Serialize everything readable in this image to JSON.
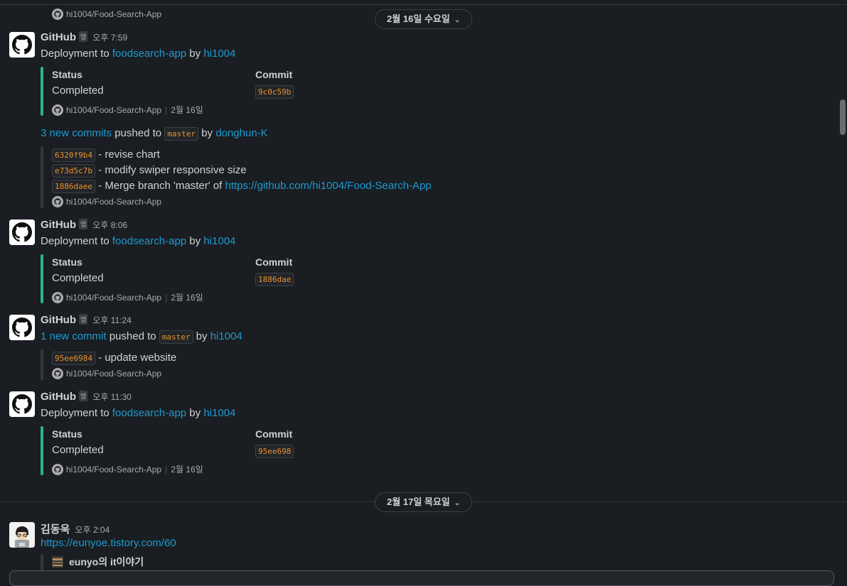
{
  "top_partial": {
    "repo": "hi1004/Food-Search-App"
  },
  "dividers": [
    {
      "label": "2월 16일 수요일"
    },
    {
      "label": "2월 17일 목요일"
    }
  ],
  "app_tag": "앱",
  "messages": [
    {
      "sender": "GitHub",
      "time": "오후 7:59",
      "text_prefix": "Deployment to ",
      "link1": "foodsearch-app",
      "text_mid": " by ",
      "link2": "hi1004",
      "status_title": "Status",
      "status_value": "Completed",
      "commit_title": "Commit",
      "commit_value": "9c0c59b",
      "repo": "hi1004/Food-Search-App",
      "date": "2월 16일"
    },
    {
      "push_link": "3 new commits",
      "push_text": " pushed  to ",
      "branch": "master",
      "by_text": " by ",
      "author": "donghun-K",
      "commits": [
        {
          "sha": "6320f9b4",
          "msg": " - revise chart"
        },
        {
          "sha": "e73d5c7b",
          "msg": " - modify swiper responsive size"
        },
        {
          "sha": "1886daee",
          "msg": " - Merge branch 'master' of ",
          "link": "https://github.com/hi1004/Food-Search-App"
        }
      ],
      "repo": "hi1004/Food-Search-App"
    },
    {
      "sender": "GitHub",
      "time": "오후 8:06",
      "text_prefix": "Deployment to ",
      "link1": "foodsearch-app",
      "text_mid": " by ",
      "link2": "hi1004",
      "status_title": "Status",
      "status_value": "Completed",
      "commit_title": "Commit",
      "commit_value": "1886dae",
      "repo": "hi1004/Food-Search-App",
      "date": "2월 16일"
    },
    {
      "sender": "GitHub",
      "time": "오후 11:24",
      "push_link": "1 new commit",
      "push_text": " pushed  to ",
      "branch": "master",
      "by_text": " by ",
      "author": "hi1004",
      "commits": [
        {
          "sha": "95ee6984",
          "msg": " - update website"
        }
      ],
      "repo": "hi1004/Food-Search-App"
    },
    {
      "sender": "GitHub",
      "time": "오후 11:30",
      "text_prefix": "Deployment to ",
      "link1": "foodsearch-app",
      "text_mid": " by ",
      "link2": "hi1004",
      "status_title": "Status",
      "status_value": "Completed",
      "commit_title": "Commit",
      "commit_value": "95ee698",
      "repo": "hi1004/Food-Search-App",
      "date": "2월 16일"
    },
    {
      "sender": "김동욱",
      "time": "오후 2:04",
      "link": "https://eunyoe.tistory.com/60",
      "preview_title": "eunyo의 it이야기"
    }
  ]
}
